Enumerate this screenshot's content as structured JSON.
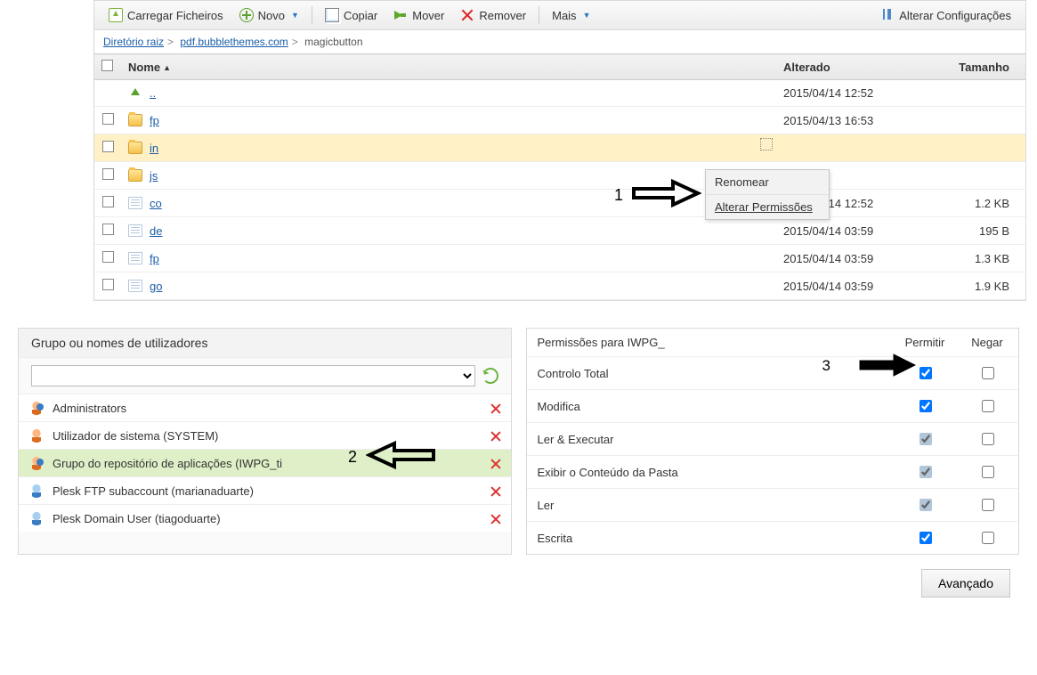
{
  "toolbar": {
    "upload": "Carregar Ficheiros",
    "new": "Novo",
    "copy": "Copiar",
    "move": "Mover",
    "remove": "Remover",
    "more": "Mais",
    "settings": "Alterar Configurações"
  },
  "breadcrumb": {
    "root": "Diretório raiz",
    "domain": "pdf.bubblethemes.com",
    "current": "magicbutton"
  },
  "columns": {
    "name": "Nome",
    "modified": "Alterado",
    "size": "Tamanho"
  },
  "rows": [
    {
      "kind": "up",
      "name": "..",
      "modified": "2015/04/14 12:52",
      "size": ""
    },
    {
      "kind": "folder",
      "name": "fp",
      "modified": "2015/04/13 16:53",
      "size": ""
    },
    {
      "kind": "folder",
      "name": "in",
      "modified": "",
      "size": "",
      "highlight": true,
      "ctx": true
    },
    {
      "kind": "folder",
      "name": "js",
      "modified": "",
      "size": ""
    },
    {
      "kind": "file",
      "name": "co",
      "modified": "2015/04/14 12:52",
      "size": "1.2 KB"
    },
    {
      "kind": "file",
      "name": "de",
      "modified": "2015/04/14 03:59",
      "size": "195 B"
    },
    {
      "kind": "file",
      "name": "fp",
      "modified": "2015/04/14 03:59",
      "size": "1.3 KB"
    },
    {
      "kind": "file",
      "name": "go",
      "modified": "2015/04/14 03:59",
      "size": "1.9 KB"
    }
  ],
  "context_menu": {
    "rename": "Renomear",
    "perms": "Alterar Permissões"
  },
  "annotations": {
    "one": "1",
    "two": "2",
    "three": "3"
  },
  "users_panel": {
    "title": "Grupo ou nomes de utilizadores",
    "list": [
      {
        "icon": "group",
        "label": "Administrators"
      },
      {
        "icon": "user",
        "label": "Utilizador de sistema (SYSTEM)"
      },
      {
        "icon": "group",
        "label": "Grupo do repositório de aplicações (IWPG_ti",
        "selected": true
      },
      {
        "icon": "blue",
        "label": "Plesk FTP subaccount (marianaduarte)"
      },
      {
        "icon": "blue",
        "label": "Plesk Domain User (tiagoduarte)"
      }
    ]
  },
  "perms_panel": {
    "title": "Permissões para IWPG_",
    "col_allow": "Permitir",
    "col_deny": "Negar",
    "rows": [
      {
        "label": "Controlo Total",
        "allow": true,
        "dim": false
      },
      {
        "label": "Modifica",
        "allow": true,
        "dim": false
      },
      {
        "label": "Ler & Executar",
        "allow": true,
        "dim": true
      },
      {
        "label": "Exibir o Conteúdo da Pasta",
        "allow": true,
        "dim": true
      },
      {
        "label": "Ler",
        "allow": true,
        "dim": true
      },
      {
        "label": "Escrita",
        "allow": true,
        "dim": false
      }
    ]
  },
  "advanced_button": "Avançado"
}
